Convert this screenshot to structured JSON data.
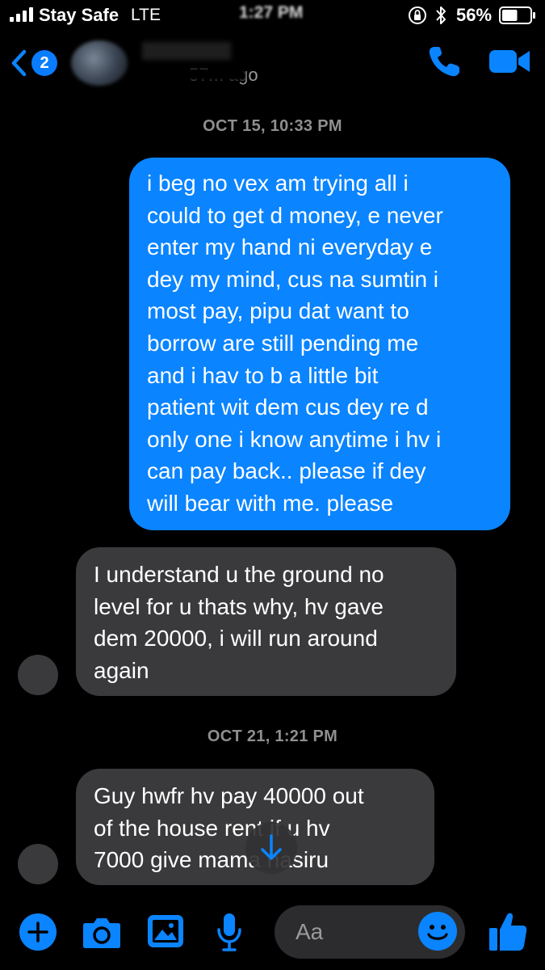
{
  "status_bar": {
    "carrier": "Stay Safe",
    "network": "LTE",
    "time": "1:27 PM",
    "battery_percent": "56%",
    "battery_level": 0.56
  },
  "header": {
    "unread_count": "2",
    "active_status": "57m ago",
    "accent_color": "#0a84ff"
  },
  "messages": [
    {
      "type": "timestamp",
      "text": "OCT 15, 10:33 PM"
    },
    {
      "type": "outgoing",
      "text": "i beg no vex am trying all i\ncould to get d money, e never\nenter my hand ni everyday e\ndey my mind, cus na sumtin i\nmost pay, pipu dat want to\nborrow are still pending me\nand i hav to b a little bit\npatient wit dem cus dey re d\nonly one i know anytime i hv i\ncan pay back.. please if dey\nwill bear with me. please"
    },
    {
      "type": "incoming",
      "text": "I understand u the ground no\nlevel for u thats why,  hv gave\ndem 20000, i will run around\nagain"
    },
    {
      "type": "timestamp",
      "text": "OCT 21, 1:21 PM"
    },
    {
      "type": "incoming",
      "text": "Guy hwfr hv pay 40000 out\nof  the house rent if u hv\n7000 give mama nasiru"
    }
  ],
  "composer": {
    "placeholder": "Aa",
    "icons": [
      "plus-icon",
      "camera-icon",
      "photo-icon",
      "mic-icon",
      "emoji-icon",
      "thumbs-up-icon"
    ]
  }
}
